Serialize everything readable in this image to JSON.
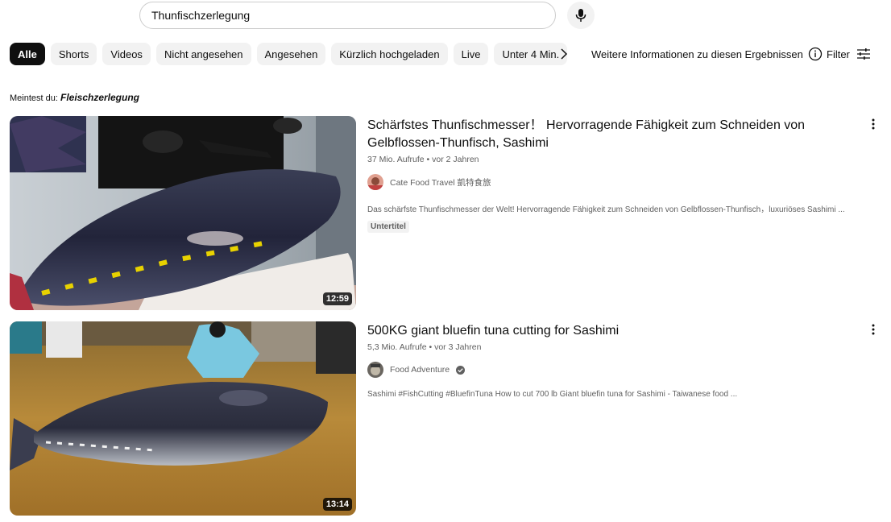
{
  "search": {
    "query": "Thunfischzerlegung"
  },
  "chips": [
    "Alle",
    "Shorts",
    "Videos",
    "Nicht angesehen",
    "Angesehen",
    "Kürzlich hochgeladen",
    "Live",
    "Unter 4 Min."
  ],
  "more_info": "Weitere Informationen zu diesen Ergebnissen",
  "filter": "Filter",
  "suggestion": {
    "prefix": "Meintest du:",
    "term": "Fleischzerlegung"
  },
  "results": [
    {
      "title": "Schärfstes Thunfischmesser！ Hervorragende Fähigkeit zum Schneiden von Gelbflossen-Thunfisch, Sashimi",
      "views": "37 Mio. Aufrufe",
      "age": "vor 2 Jahren",
      "channel": "Cate Food Travel 凱特食旅",
      "description": "Das schärfste Thunfischmesser der Welt! Hervorragende Fähigkeit zum Schneiden von Gelbflossen-Thunfisch，luxuriöses Sashimi ...",
      "badge": "Untertitel",
      "duration": "12:59"
    },
    {
      "title": "500KG giant bluefin tuna cutting for Sashimi",
      "views": "5,3 Mio. Aufrufe",
      "age": "vor 3 Jahren",
      "channel": "Food Adventure",
      "description": "Sashimi #FishCutting #BluefinTuna How to cut 700 lb Giant bluefin tuna for Sashimi - Taiwanese food ...",
      "duration": "13:14"
    }
  ],
  "meta_separator": "•"
}
